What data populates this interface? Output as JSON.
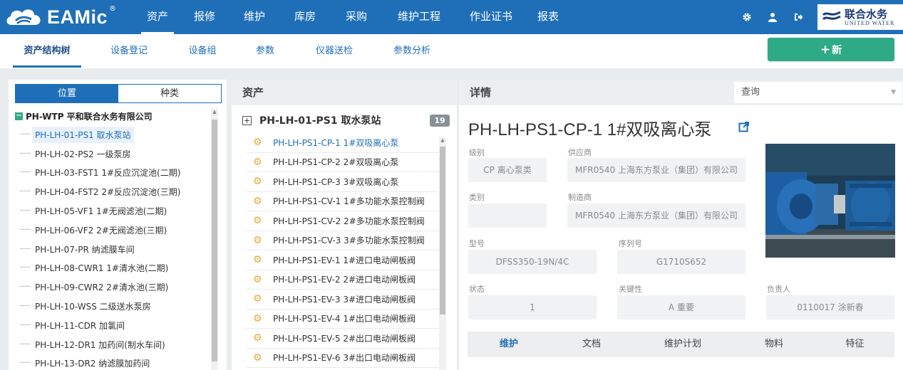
{
  "app": {
    "logo_text": "EAMic",
    "logo_reg": "®",
    "brand_cn": "联合水务",
    "brand_en": "UNITED WATER"
  },
  "nav": {
    "items": [
      "资产",
      "报修",
      "维护",
      "库房",
      "采购",
      "维护工程",
      "作业证书",
      "报表"
    ],
    "active": "资产"
  },
  "top_icons": [
    "gear-icon",
    "user-icon",
    "logout-icon"
  ],
  "subnav": {
    "items": [
      "资产结构树",
      "设备登记",
      "设备组",
      "参数",
      "仪器送检",
      "参数分析"
    ],
    "active": "资产结构树"
  },
  "new_button": {
    "icon": "+",
    "label": "新"
  },
  "left_panel": {
    "tabs": [
      "位置",
      "种类"
    ],
    "active_tab": "位置",
    "root": "PH-WTP 平和联合水务有限公司",
    "items": [
      "PH-LH-01-PS1 取水泵站",
      "PH-LH-02-PS2 一级泵房",
      "PH-LH-03-FST1 1#反应沉淀池(二期)",
      "PH-LH-04-FST2 2#反应沉淀池(三期)",
      "PH-LH-05-VF1 1#无阀滤池(二期)",
      "PH-LH-06-VF2 2#无阀滤池(三期)",
      "PH-LH-07-PR 纳滤膜车间",
      "PH-LH-08-CWR1 1#清水池(二期)",
      "PH-LH-09-CWR2 2#清水池(三期)",
      "PH-LH-10-WSS 二级送水泵房",
      "PH-LH-11-CDR 加氯间",
      "PH-LH-12-DR1 加药间(制水车间)",
      "PH-LH-13-DR2 纳滤膜加药间"
    ],
    "selected_index": 0
  },
  "mid_panel": {
    "title": "资产",
    "group": "PH-LH-01-PS1 取水泵站",
    "count": "19",
    "items": [
      "PH-LH-PS1-CP-1 1#双吸离心泵",
      "PH-LH-PS1-CP-2 2#双吸离心泵",
      "PH-LH-PS1-CP-3 3#双吸离心泵",
      "PH-LH-PS1-CV-1 1#多功能水泵控制阀",
      "PH-LH-PS1-CV-2 2#多功能水泵控制阀",
      "PH-LH-PS1-CV-3 3#多功能水泵控制阀",
      "PH-LH-PS1-EV-1 1#进口电动闸板阀",
      "PH-LH-PS1-EV-2 2#进口电动闸板阀",
      "PH-LH-PS1-EV-3 3#进口电动闸板阀",
      "PH-LH-PS1-EV-4 1#出口电动闸板阀",
      "PH-LH-PS1-EV-5 2#出口电动闸板阀",
      "PH-LH-PS1-EV-6 3#出口电动闸板阀"
    ],
    "selected_index": 0
  },
  "detail": {
    "title": "详情",
    "query_placeholder": "查询",
    "asset_title": "PH-LH-PS1-CP-1 1#双吸离心泵",
    "fields": {
      "level_label": "级别",
      "level_value": "CP 离心泵类",
      "supplier_label": "供应商",
      "supplier_value": "MFR0540 上海东方泵业（集团）有限公司",
      "category_label": "类别",
      "category_value": "",
      "manufacturer_label": "制造商",
      "manufacturer_value": "MFR0540 上海东方泵业（集团）有限公司",
      "model_label": "型号",
      "model_value": "DFSS350-19N/4C",
      "serial_label": "序列号",
      "serial_value": "G1710S652",
      "status_label": "状态",
      "status_value": "1",
      "criticality_label": "关键性",
      "criticality_value": "A 重要",
      "owner_label": "负责人",
      "owner_value": "0110017 涂新春"
    },
    "tabs": [
      "维护",
      "文档",
      "维护计划",
      "物料",
      "特征"
    ],
    "active_tab": "维护"
  },
  "colors": {
    "primary": "#1f6fb8",
    "accent_green": "#2eaa86",
    "badge_gray": "#8a9097",
    "gear_orange": "#e8a93a"
  }
}
